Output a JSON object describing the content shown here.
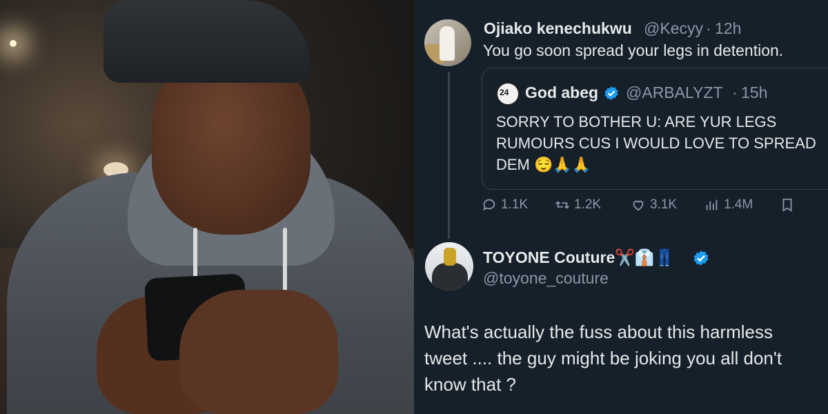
{
  "photo": {
    "alt_subject": "person-looking-at-phone"
  },
  "tweet": {
    "author_name": "Ojiako kenechukwu",
    "author_handle": "@Kecyy",
    "separator": "·",
    "time": "12h",
    "text": "You go soon spread your legs in detention."
  },
  "quote": {
    "author_name": "God abeg",
    "author_handle": "@ARBALYZT",
    "separator": "·",
    "time": "15h",
    "lines": [
      "SORRY TO BOTHER U: ARE YUR LEGS",
      "RUMOURS CUS I WOULD LOVE TO SPREAD",
      "DEM 😌🙏🙏"
    ]
  },
  "actions": {
    "replies": "1.1K",
    "retweets": "1.2K",
    "likes": "3.1K",
    "views": "1.4M"
  },
  "reply": {
    "author_name": "TOYONE Couture✂️👔👖",
    "author_handle": "@toyone_couture",
    "lines": [
      "What's actually the fuss about this harmless",
      "tweet .... the guy might be joking you all don't",
      "know that ?"
    ]
  },
  "colors": {
    "background": "#15202b",
    "text": "#e7e9ea",
    "muted": "#8b98a5",
    "verified": "#1d9bf0",
    "border": "#38444d"
  }
}
